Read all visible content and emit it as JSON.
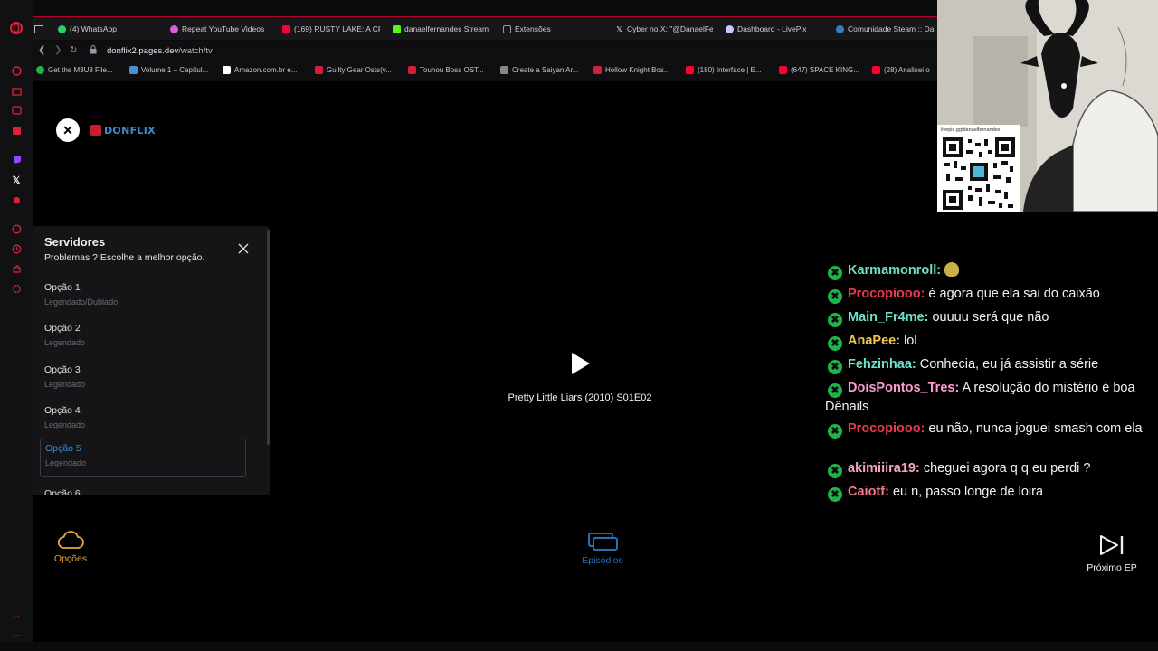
{
  "browser": {
    "tabs": [
      {
        "label": "(4) WhatsApp",
        "color": "#25d366"
      },
      {
        "label": "Repeat YouTube Videos",
        "color": "#e05ad0"
      },
      {
        "label": "(169) RUSTY LAKE: A CR",
        "color": "#ff0033"
      },
      {
        "label": "danaelfernandes Stream",
        "color": "#53fc18"
      },
      {
        "label": "Extensões",
        "color": "#9a9aa0"
      },
      {
        "label": "Cyber no X: \"@DanaelFe",
        "color": "#ffffff"
      },
      {
        "label": "Dashboard - LivePix",
        "color": "#c9c9ff"
      },
      {
        "label": "Comunidade Steam :: Da",
        "color": "#3b7bc4"
      }
    ],
    "url_domain": "donflix2.pages.dev",
    "url_path": "/watch/tv",
    "bookmarks": [
      {
        "label": "Get the M3U8 File...",
        "color": "#1fb449"
      },
      {
        "label": "Volume 1 – Capítul...",
        "color": "#4a8fd6"
      },
      {
        "label": "Amazon.com.br e...",
        "color": "#ffffff"
      },
      {
        "label": "Guilty Gear Osts(v...",
        "color": "#d3203a"
      },
      {
        "label": "Touhou Boss OST...",
        "color": "#d3203a"
      },
      {
        "label": "Create a Saiyan Ar...",
        "color": "#888888"
      },
      {
        "label": "Hollow Knight Bos...",
        "color": "#d3203a"
      },
      {
        "label": "(180) Interface | E...",
        "color": "#ff0033"
      },
      {
        "label": "(647) SPACE KING...",
        "color": "#ff0033"
      },
      {
        "label": "(28) Analisei o",
        "color": "#ff0033"
      }
    ]
  },
  "player": {
    "brand": "DONFLIX",
    "episode_title": "Pretty Little Liars (2010) S01E02",
    "servers_panel": {
      "title": "Servidores",
      "subtitle": "Problemas ? Escolhe a melhor opção.",
      "options": [
        {
          "label": "Opção 1",
          "sub": "Legendado/Dublado"
        },
        {
          "label": "Opção 2",
          "sub": "Legendado"
        },
        {
          "label": "Opção 3",
          "sub": "Legendado"
        },
        {
          "label": "Opção 4",
          "sub": "Legendado"
        },
        {
          "label": "Opção 5",
          "sub": "Legendado"
        },
        {
          "label": "Opção 6",
          "sub": ""
        }
      ],
      "selected": "Opção 5"
    },
    "controls": {
      "options_label": "Opções",
      "episodes_label": "Episódios",
      "next_label": "Próximo EP"
    }
  },
  "stream_overlay": {
    "qr_url": "livepix.gg/danaelfernandes",
    "chat": [
      {
        "user": "Karmamonroll:",
        "text": "",
        "color": "#6fe0c8"
      },
      {
        "user": "Procopiooo:",
        "text": "é agora que ela sai do caixão",
        "color": "#e83a4e"
      },
      {
        "user": "Main_Fr4me:",
        "text": "ouuuu será que não",
        "color": "#6fe0c8"
      },
      {
        "user": "AnaPee:",
        "text": "lol",
        "color": "#f2c94c"
      },
      {
        "user": "Fehzinhaa:",
        "text": "Conhecia, eu já assistir a série",
        "color": "#6fe0c8"
      },
      {
        "user": "DoisPontos_Tres:",
        "text": "A resolução do mistério é boa Dênails",
        "color": "#ff9ccf"
      },
      {
        "user": "Procopiooo:",
        "text": "eu não, nunca joguei smash com ela",
        "color": "#e83a4e"
      },
      {
        "user": "akimiiira19:",
        "text": "cheguei agora q q eu perdi ?",
        "color": "#f4a6b8"
      },
      {
        "user": "Caiotf:",
        "text": "eu n, passo longe de loira",
        "color": "#f27a8a"
      }
    ]
  }
}
